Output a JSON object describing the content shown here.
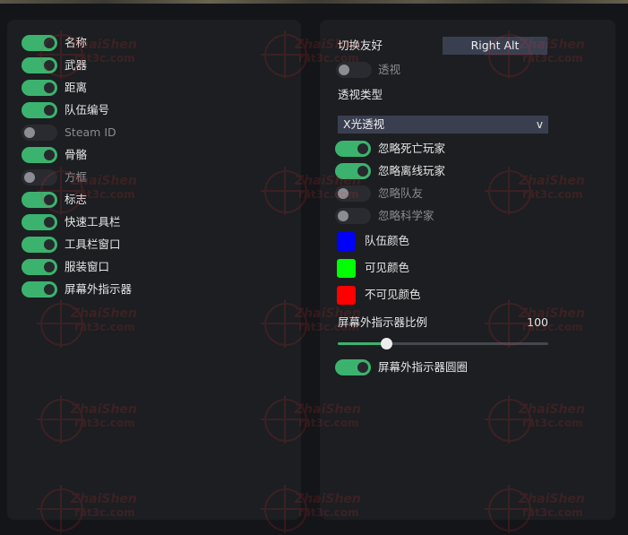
{
  "left_panel": {
    "items": [
      {
        "label": "名称",
        "on": true
      },
      {
        "label": "武器",
        "on": true
      },
      {
        "label": "距离",
        "on": true
      },
      {
        "label": "队伍编号",
        "on": true
      },
      {
        "label": "Steam ID",
        "on": false
      },
      {
        "label": "骨骼",
        "on": true
      },
      {
        "label": "方框",
        "on": false
      },
      {
        "label": "标志",
        "on": true
      },
      {
        "label": "快速工具栏",
        "on": true
      },
      {
        "label": "工具栏窗口",
        "on": true
      },
      {
        "label": "服装窗口",
        "on": true
      },
      {
        "label": "屏幕外指示器",
        "on": true
      }
    ]
  },
  "right_panel": {
    "toggle_friendly": {
      "label": "切换友好",
      "key": "Right Alt"
    },
    "see_through": {
      "label": "透视",
      "on": false
    },
    "see_through_type": {
      "label": "透视类型",
      "selected": "X光透视",
      "chevron": "v"
    },
    "toggles": [
      {
        "label": "忽略死亡玩家",
        "on": true
      },
      {
        "label": "忽略离线玩家",
        "on": true
      },
      {
        "label": "忽略队友",
        "on": false
      },
      {
        "label": "忽略科学家",
        "on": false
      }
    ],
    "colors": [
      {
        "label": "队伍颜色",
        "color": "#0000ff"
      },
      {
        "label": "可见颜色",
        "color": "#00ff00"
      },
      {
        "label": "不可见颜色",
        "color": "#ff0000"
      }
    ],
    "indicator_scale": {
      "label": "屏幕外指示器比例",
      "value": "100",
      "fraction": 0.23
    },
    "indicator_circle": {
      "label": "屏幕外指示器圆圈",
      "on": true
    }
  },
  "watermark": {
    "line1": "ZhaiShen",
    "line2": "rat3c.com"
  },
  "theme": {
    "accent": "#3bb36e",
    "panel": "#1c1e21",
    "field": "#3a3f50"
  }
}
